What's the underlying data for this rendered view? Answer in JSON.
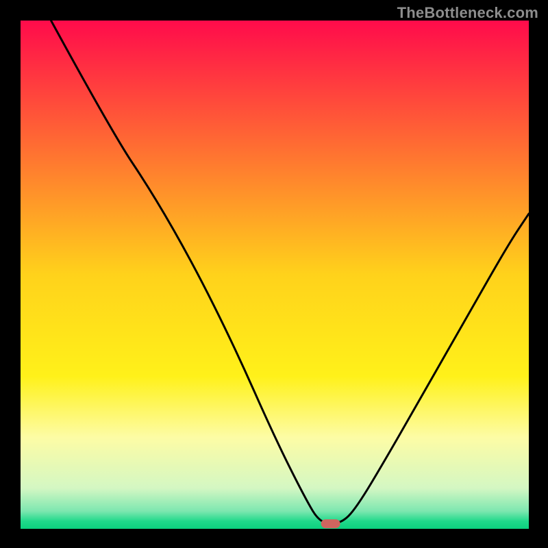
{
  "watermark": "TheBottleneck.com",
  "chart_data": {
    "type": "line",
    "title": "",
    "xlabel": "",
    "ylabel": "",
    "xlim": [
      0,
      100
    ],
    "ylim": [
      0,
      100
    ],
    "grid": false,
    "background_gradient_stops": [
      {
        "offset": 0.0,
        "color": "#ff0b4b"
      },
      {
        "offset": 0.25,
        "color": "#ff6e32"
      },
      {
        "offset": 0.5,
        "color": "#ffd21b"
      },
      {
        "offset": 0.7,
        "color": "#fff11a"
      },
      {
        "offset": 0.82,
        "color": "#fdfca5"
      },
      {
        "offset": 0.92,
        "color": "#d4f7c3"
      },
      {
        "offset": 0.965,
        "color": "#7de7b0"
      },
      {
        "offset": 0.985,
        "color": "#20d98b"
      },
      {
        "offset": 1.0,
        "color": "#0bd07e"
      }
    ],
    "series": [
      {
        "name": "bottleneck-curve",
        "color": "#000000",
        "points": [
          {
            "x": 6,
            "y": 100
          },
          {
            "x": 18,
            "y": 78
          },
          {
            "x": 26,
            "y": 66
          },
          {
            "x": 34,
            "y": 52
          },
          {
            "x": 42,
            "y": 36
          },
          {
            "x": 50,
            "y": 18
          },
          {
            "x": 56,
            "y": 6
          },
          {
            "x": 59,
            "y": 1
          },
          {
            "x": 63,
            "y": 1
          },
          {
            "x": 66,
            "y": 4
          },
          {
            "x": 72,
            "y": 14
          },
          {
            "x": 80,
            "y": 28
          },
          {
            "x": 88,
            "y": 42
          },
          {
            "x": 96,
            "y": 56
          },
          {
            "x": 100,
            "y": 62
          }
        ]
      }
    ],
    "marker": {
      "name": "minimum-marker",
      "x": 61,
      "y": 1,
      "color": "#d0655f"
    }
  }
}
